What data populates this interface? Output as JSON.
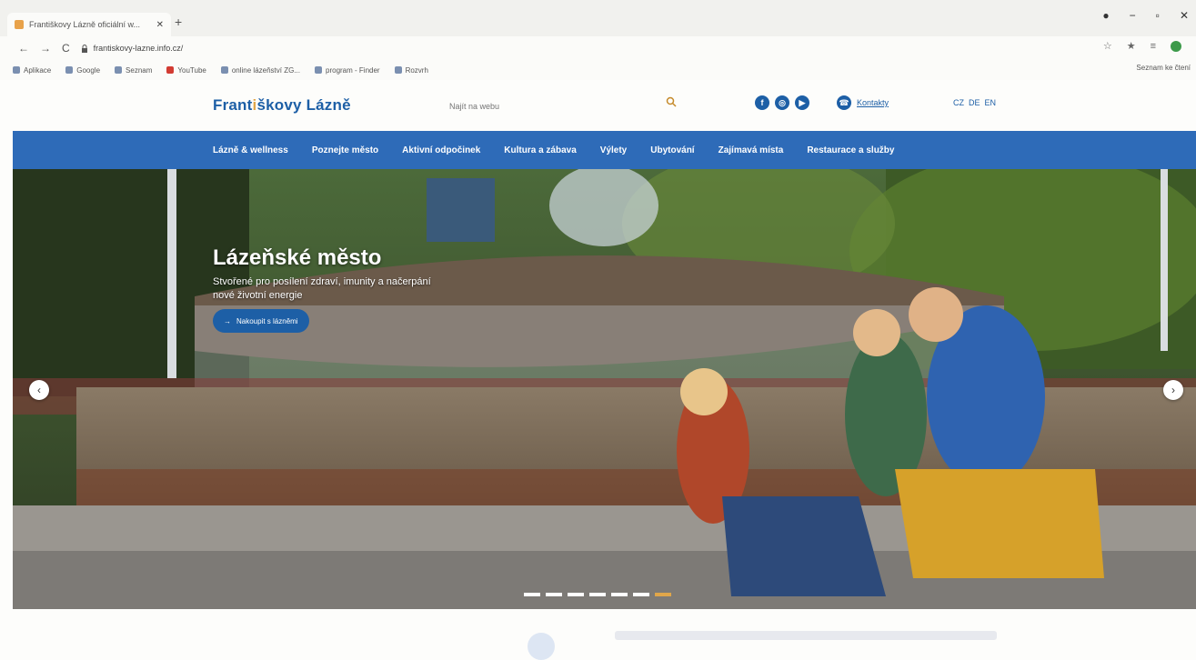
{
  "browser": {
    "tab_title": "Františkovy Lázně oficiální w...",
    "tab_close": "✕",
    "new_tab": "+",
    "window_controls": [
      "●",
      "−",
      "▫",
      "✕"
    ],
    "nav": [
      "←",
      "→",
      "C"
    ],
    "url": "frantiskovy-lazne.info.cz/",
    "right_icons": [
      "☆",
      "★",
      "≡"
    ],
    "reading_list": "Seznam ke čtení",
    "bookmarks": [
      {
        "label": "Aplikace"
      },
      {
        "label": "Google"
      },
      {
        "label": "Seznam"
      },
      {
        "label": "YouTube"
      },
      {
        "label": "online lázeňství ZG..."
      },
      {
        "label": "program - Finder"
      },
      {
        "label": "Rozvrh"
      }
    ]
  },
  "header": {
    "logo_pre": "Frant",
    "logo_mark": "i",
    "logo_post": "škovy Lázně",
    "search_placeholder": "Najít na webu",
    "socials": [
      "f",
      "◎",
      "▶"
    ],
    "contact_label": "Kontakty",
    "langs": [
      "CZ",
      "DE",
      "EN"
    ]
  },
  "nav": {
    "items": [
      "Lázně & wellness",
      "Poznejte město",
      "Aktivní odpočinek",
      "Kultura a zábava",
      "Výlety",
      "Ubytování",
      "Zajímavá místa",
      "Restaurace a služby"
    ]
  },
  "hero": {
    "title": "Lázeňské město",
    "subtitle": "Stvořené pro posílení zdraví, imunity a načerpání nové životní energie",
    "cta": "Nakoupit s lázněmi",
    "prev": "‹",
    "next": "›",
    "slide_count": 7,
    "active_slide": 6
  },
  "colors": {
    "brand_blue": "#2e6bb8",
    "accent_gold": "#e0a64a"
  }
}
